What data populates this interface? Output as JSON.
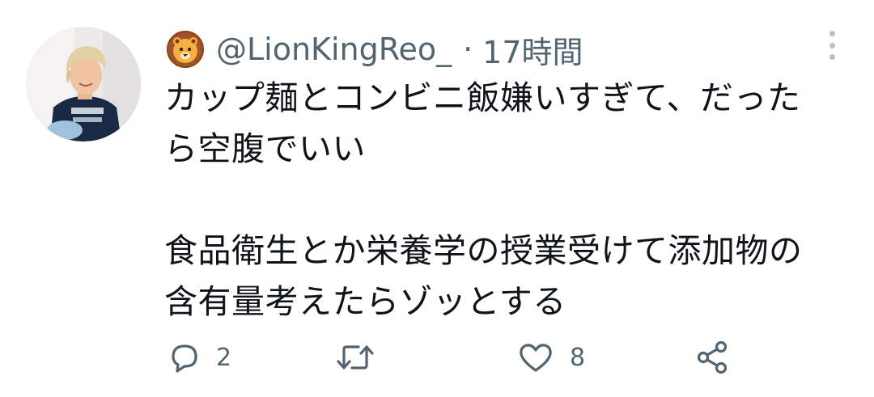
{
  "tweet": {
    "handle": "@LionKingReo_",
    "separator": "·",
    "time": "17時間",
    "badge_icon": "lion-emoji-icon",
    "lines_1": [
      "カップ麺とコンビニ飯嫌いすぎて、だった",
      "ら空腹でいい"
    ],
    "lines_2": [
      "食品衛生とか栄養学の授業受けて添加物の",
      "含有量考えたらゾッとする"
    ]
  },
  "actions": {
    "reply_count": "2",
    "retweet_count": "",
    "like_count": "8"
  },
  "colors": {
    "text": "#0f1419",
    "secondary": "#536471",
    "dots": "#b9c0c6"
  }
}
